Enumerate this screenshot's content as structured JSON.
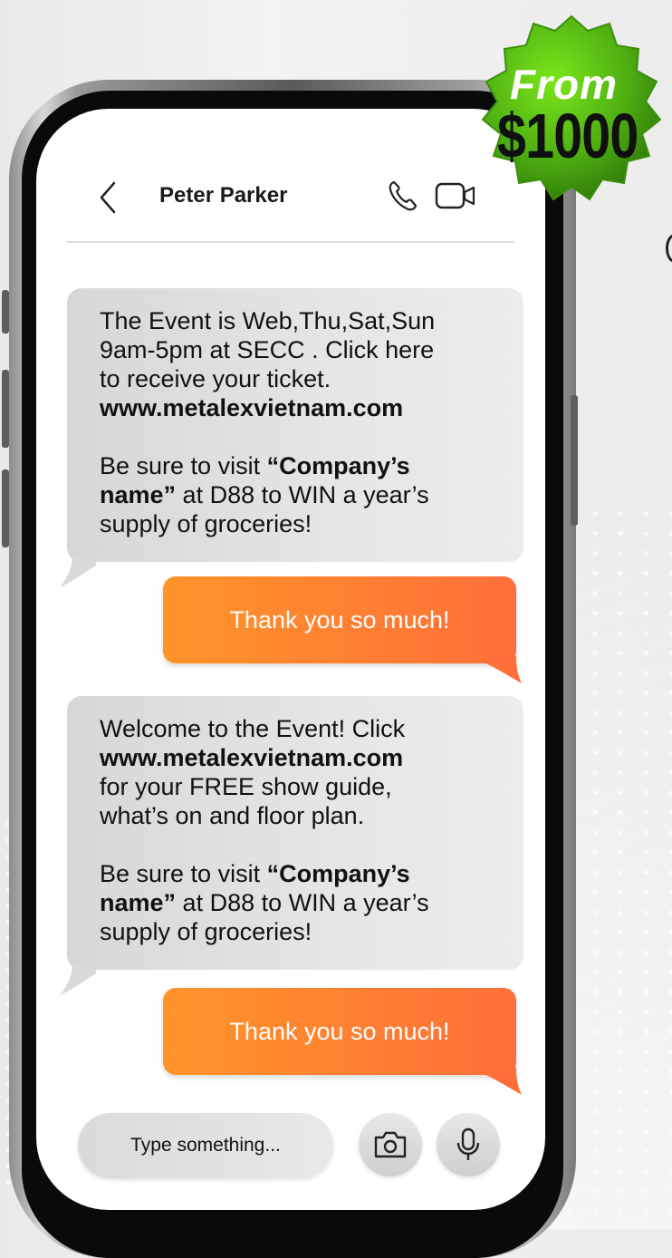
{
  "chat": {
    "contact_name": "Peter Parker",
    "messages": [
      {
        "direction": "incoming",
        "line1": "The Event is Web,Thu,Sat,Sun",
        "line2": "9am-5pm at SECC . Click here",
        "line3": "to receive your ticket.",
        "link": "www.metalexvietnam.com",
        "p2_prefix": "Be sure to visit ",
        "company": "“Company’s",
        "company2": "name”",
        "p2_mid": " at D88 to WIN a year’s",
        "p2_end": "supply of groceries!"
      },
      {
        "direction": "outgoing",
        "text": "Thank you so much!"
      },
      {
        "direction": "incoming",
        "line1": "Welcome to the Event! Click",
        "link": "www.metalexvietnam.com",
        "line3": "for your FREE show guide,",
        "line4": "what’s on and floor plan.",
        "p2_prefix": "Be sure to visit ",
        "company": "“Company’s",
        "company2": "name”",
        "p2_mid": " at D88 to WIN a year’s",
        "p2_end": "supply of groceries!"
      },
      {
        "direction": "outgoing",
        "text": "Thank you so much!"
      }
    ]
  },
  "composer": {
    "placeholder": "Type something..."
  },
  "badge": {
    "line1": "From",
    "line2": "$1000"
  },
  "icons": [
    "back-icon",
    "phone-call-icon",
    "video-call-icon",
    "camera-icon",
    "microphone-icon"
  ],
  "colors": {
    "outgoing_bubble": "#ff8030",
    "incoming_bubble": "#e2e2e2",
    "badge_green": "#5fc70f"
  }
}
